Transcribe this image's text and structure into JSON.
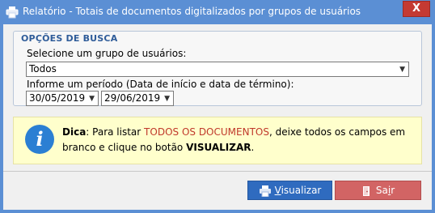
{
  "window": {
    "title": "Relatório - Totais de documentos digitalizados por grupos de usuários",
    "close_label": "X"
  },
  "search": {
    "legend": "OPÇÕES DE BUSCA",
    "group_label": "Selecione um grupo de usuários:",
    "group_value": "Todos",
    "period_label": "Informe um período (Data de início e data de término):",
    "start_date": "30/05/2019",
    "end_date": "29/06/2019"
  },
  "tip": {
    "icon": "info-icon",
    "prefix": "Dica",
    "text_before": ": Para listar ",
    "highlight": "TODOS OS DOCUMENTOS",
    "text_middle": ", deixe todos os campos em branco e clique no botão ",
    "bold_word": "VISUALIZAR",
    "text_after": "."
  },
  "buttons": {
    "visualizar_first": "V",
    "visualizar_rest": "isualizar",
    "sair_first": "Sa",
    "sair_under": "i",
    "sair_rest": "r"
  },
  "colors": {
    "titlebar": "#5b8fd4",
    "close": "#c43a32",
    "visualizar": "#2f6bbf",
    "sair": "#d26464",
    "highlight": "#c0392b",
    "tip_bg": "#ffffcc"
  }
}
